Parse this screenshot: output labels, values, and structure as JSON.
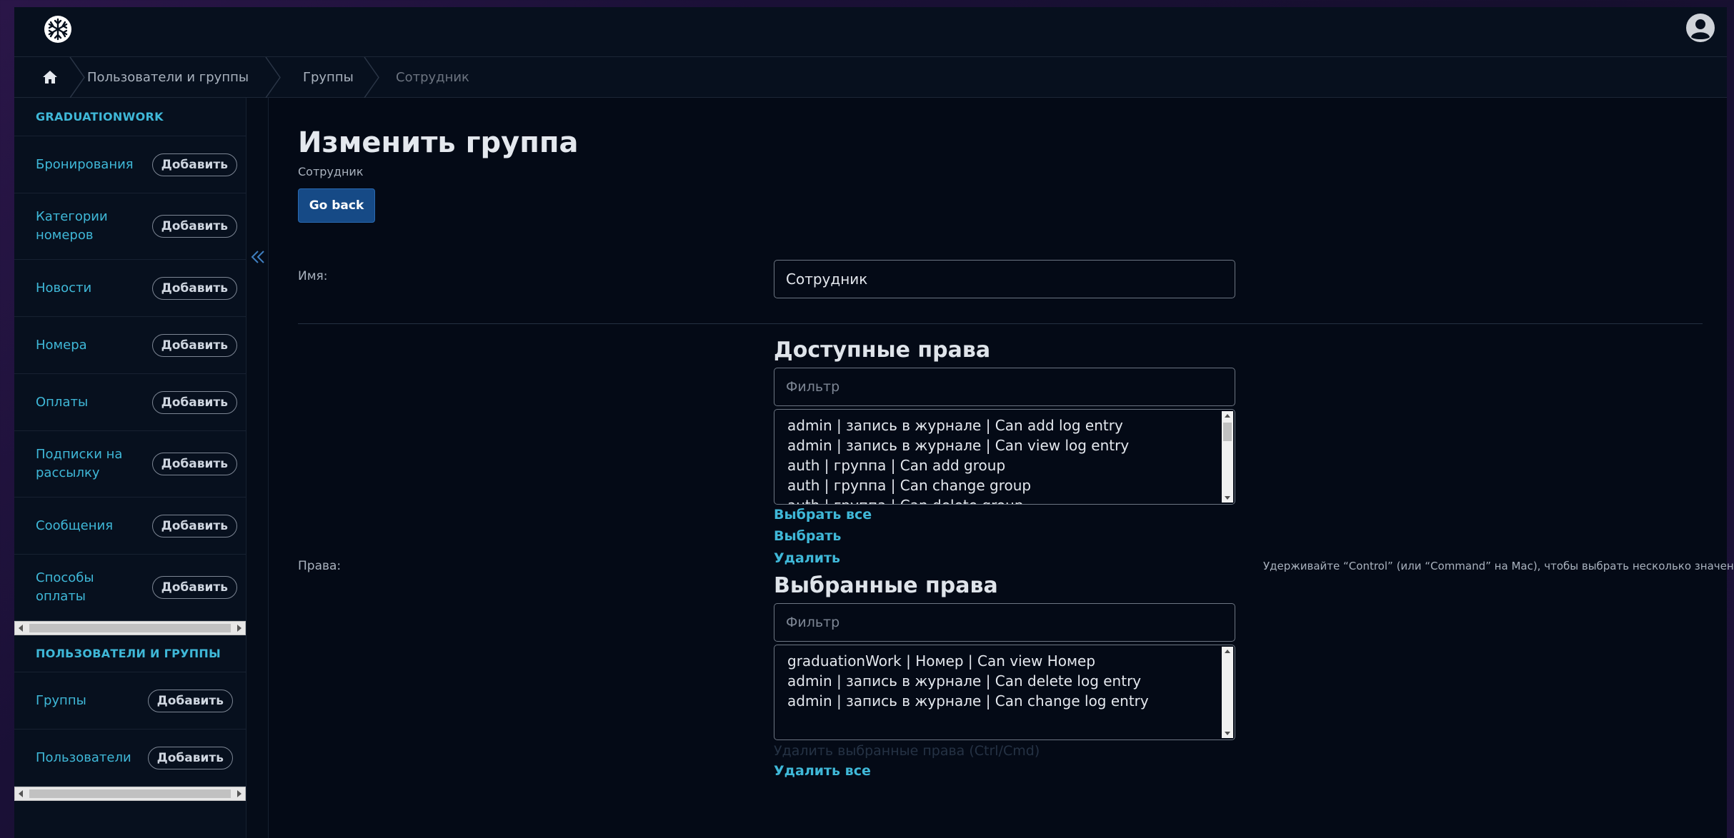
{
  "breadcrumb": {
    "items": [
      "Пользователи и группы",
      "Группы",
      "Сотрудник"
    ]
  },
  "sidebar": {
    "sections": [
      {
        "title": "GRADUATIONWORK",
        "items": [
          {
            "label": "Бронирования",
            "add": "Добавить"
          },
          {
            "label": "Категории номеров",
            "add": "Добавить"
          },
          {
            "label": "Новости",
            "add": "Добавить"
          },
          {
            "label": "Номера",
            "add": "Добавить"
          },
          {
            "label": "Оплаты",
            "add": "Добавить"
          },
          {
            "label": "Подписки на рассылку",
            "add": "Добавить"
          },
          {
            "label": "Сообщения",
            "add": "Добавить"
          },
          {
            "label": "Способы оплаты",
            "add": "Добавить"
          }
        ]
      },
      {
        "title": "ПОЛЬЗОВАТЕЛИ И ГРУППЫ",
        "items": [
          {
            "label": "Группы",
            "add": "Добавить"
          },
          {
            "label": "Пользователи",
            "add": "Добавить"
          }
        ]
      }
    ]
  },
  "main": {
    "title": "Изменить группа",
    "subtitle": "Сотрудник",
    "back_button": "Go back",
    "name_label": "Имя:",
    "name_value": "Сотрудник",
    "permissions_label": "Права:",
    "available": {
      "title": "Доступные права",
      "filter_placeholder": "Фильтр",
      "options": [
        "admin | запись в журнале | Can add log entry",
        "admin | запись в журнале | Can view log entry",
        "auth | группа | Can add group",
        "auth | группа | Can change group",
        "auth | группа | Can delete group"
      ],
      "select_all": "Выбрать все",
      "choose": "Выбрать",
      "remove": "Удалить"
    },
    "chosen": {
      "title": "Выбранные права",
      "filter_placeholder": "Фильтр",
      "options": [
        "graduationWork | Номер | Can view Номер",
        "admin | запись в журнале | Can delete log entry",
        "admin | запись в журнале | Can change log entry"
      ],
      "hidden_hint": "Удалить выбранные права (Ctrl/Cmd)",
      "remove_all": "Удалить все"
    },
    "help_text": "Удерживайте “Control” (или “Command” на Mac), чтобы выбрать несколько значений."
  },
  "colors": {
    "accent": "#3fb8d8",
    "button_primary": "#164a86",
    "background": "#040a16",
    "panel": "#07101e"
  }
}
